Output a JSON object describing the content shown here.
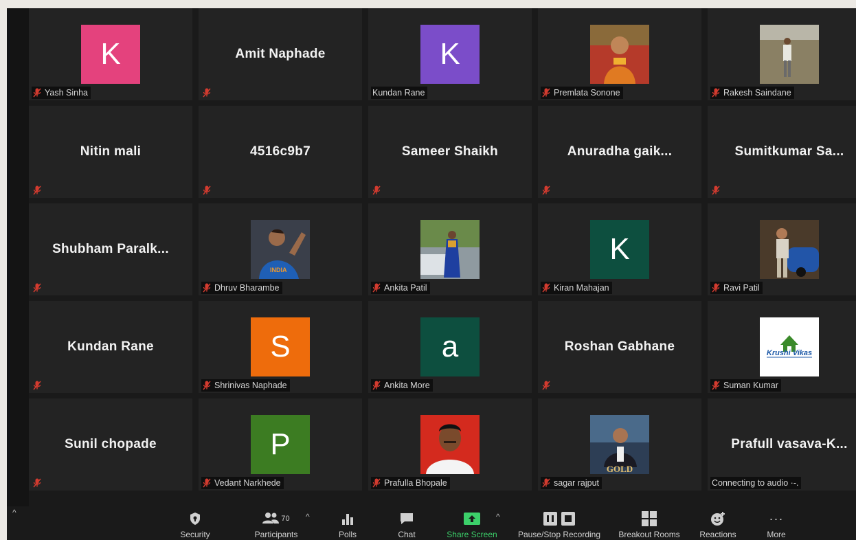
{
  "participants": [
    {
      "name": "Yash Sinha",
      "kind": "avatar",
      "letter": "K",
      "color": "#e4427d"
    },
    {
      "name": "Amit Naphade",
      "kind": "name",
      "label": ""
    },
    {
      "name": "Kundan Rane",
      "kind": "avatar",
      "letter": "K",
      "color": "#7b4dc9",
      "muted": false
    },
    {
      "name": "Premlata Sonone",
      "kind": "photo",
      "photo": "woman-orange-saree-photo"
    },
    {
      "name": "Rakesh Saindane",
      "kind": "photo",
      "photo": "man-in-field-photo"
    },
    {
      "name": "Nitin mali",
      "kind": "name",
      "label": ""
    },
    {
      "name": "4516c9b7",
      "kind": "name",
      "label": ""
    },
    {
      "name": "Sameer Shaikh",
      "kind": "name",
      "label": ""
    },
    {
      "name": "Anuradha gaik...",
      "kind": "name",
      "label": ""
    },
    {
      "name": "Sumitkumar Sa...",
      "kind": "name",
      "label": ""
    },
    {
      "name": "Shubham Paralk...",
      "kind": "name",
      "label": ""
    },
    {
      "name": "Dhruv Bharambe",
      "kind": "photo",
      "photo": "cricketer-photo"
    },
    {
      "name": "Ankita Patil",
      "kind": "photo",
      "photo": "woman-blue-saree-photo"
    },
    {
      "name": "Kiran Mahajan",
      "kind": "avatar",
      "letter": "K",
      "color": "#0d4f3f"
    },
    {
      "name": "Ravi Patil",
      "kind": "photo",
      "photo": "man-with-car-photo"
    },
    {
      "name": "Kundan Rane",
      "kind": "name",
      "label": ""
    },
    {
      "name": "Shrinivas Naphade",
      "kind": "avatar",
      "letter": "S",
      "color": "#ee6c0c"
    },
    {
      "name": "Ankita More",
      "kind": "avatar",
      "letter": "a",
      "color": "#0d4f3f"
    },
    {
      "name": "Roshan Gabhane",
      "kind": "name",
      "label": ""
    },
    {
      "name": "Suman Kumar",
      "kind": "logo",
      "logo_text": "Krushi Vikas"
    },
    {
      "name": "Sunil chopade",
      "kind": "name",
      "label": ""
    },
    {
      "name": "Vedant Narkhede",
      "kind": "avatar",
      "letter": "P",
      "color": "#3c7c22"
    },
    {
      "name": "Prafulla Bhopale",
      "kind": "photo",
      "photo": "man-portrait-red-bg-photo"
    },
    {
      "name": "sagar rajput",
      "kind": "photo",
      "photo": "gold-movie-poster-photo",
      "poster_text": "GOLD"
    },
    {
      "name": "Prafull vasava-K...",
      "kind": "name",
      "label": "Connecting to audio ·-.",
      "muted": false
    }
  ],
  "toolbar": {
    "security": "Security",
    "participants": "Participants",
    "participant_count": "70",
    "polls": "Polls",
    "chat": "Chat",
    "share_screen": "Share Screen",
    "recording": "Pause/Stop Recording",
    "breakout": "Breakout Rooms",
    "reactions": "Reactions",
    "more": "More",
    "more_dots": "···",
    "caret": "^"
  },
  "colors": {
    "share_green": "#3cd06a",
    "muted_red": "#d33b2f"
  }
}
